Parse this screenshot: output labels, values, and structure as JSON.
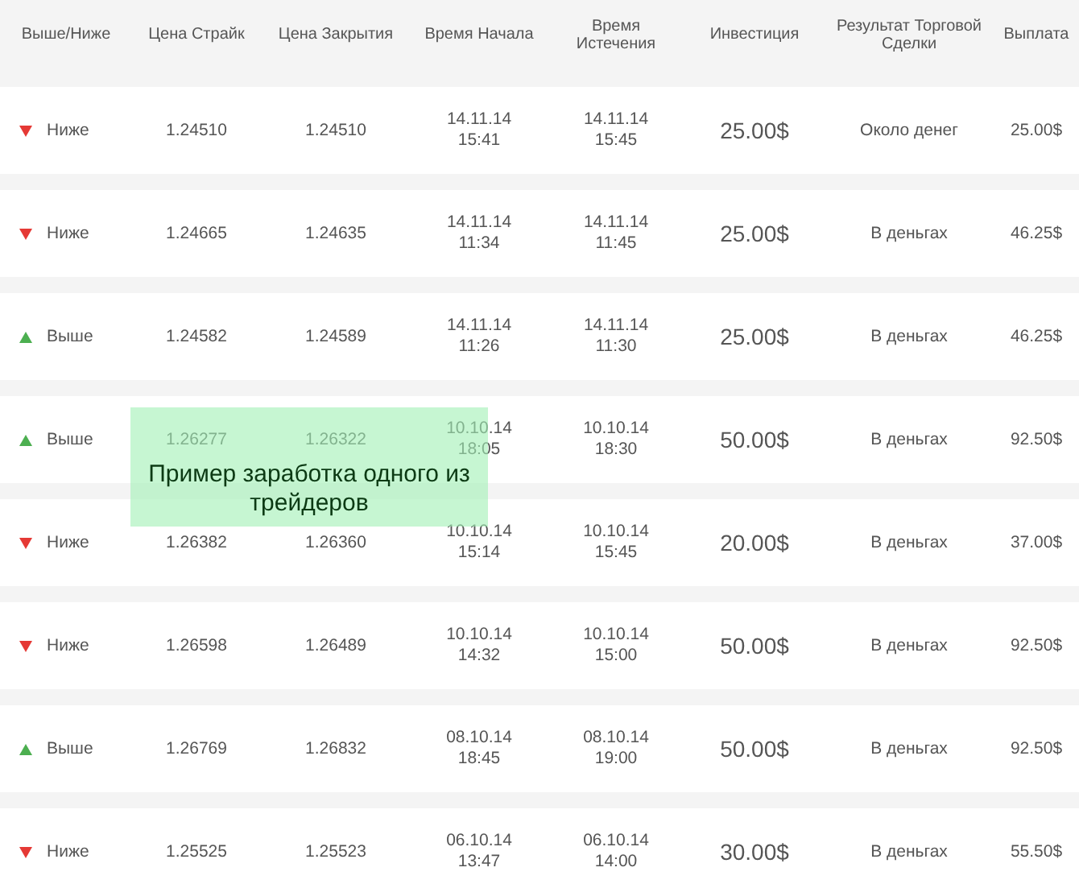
{
  "columns": [
    "Выше/Ниже",
    "Цена Страйк",
    "Цена Закрытия",
    "Время Начала",
    "Время Истечения",
    "Инвестиция",
    "Результат Торговой Сделки",
    "Выплата"
  ],
  "rows": [
    {
      "kind": "down",
      "label": "Ниже",
      "strike": "1.24510",
      "close": "1.24510",
      "start_date": "14.11.14",
      "start_time": "15:41",
      "expiry_date": "14.11.14",
      "expiry_time": "15:45",
      "investment": "25.00$",
      "result": "Около денег",
      "payout": "25.00$"
    },
    {
      "kind": "down",
      "label": "Ниже",
      "strike": "1.24665",
      "close": "1.24635",
      "start_date": "14.11.14",
      "start_time": "11:34",
      "expiry_date": "14.11.14",
      "expiry_time": "11:45",
      "investment": "25.00$",
      "result": "В деньгах",
      "payout": "46.25$"
    },
    {
      "kind": "up",
      "label": "Выше",
      "strike": "1.24582",
      "close": "1.24589",
      "start_date": "14.11.14",
      "start_time": "11:26",
      "expiry_date": "14.11.14",
      "expiry_time": "11:30",
      "investment": "25.00$",
      "result": "В деньгах",
      "payout": "46.25$"
    },
    {
      "kind": "up",
      "label": "Выше",
      "strike": "1.26277",
      "close": "1.26322",
      "start_date": "10.10.14",
      "start_time": "18:05",
      "expiry_date": "10.10.14",
      "expiry_time": "18:30",
      "investment": "50.00$",
      "result": "В деньгах",
      "payout": "92.50$"
    },
    {
      "kind": "down",
      "label": "Ниже",
      "strike": "1.26382",
      "close": "1.26360",
      "start_date": "10.10.14",
      "start_time": "15:14",
      "expiry_date": "10.10.14",
      "expiry_time": "15:45",
      "investment": "20.00$",
      "result": "В деньгах",
      "payout": "37.00$"
    },
    {
      "kind": "down",
      "label": "Ниже",
      "strike": "1.26598",
      "close": "1.26489",
      "start_date": "10.10.14",
      "start_time": "14:32",
      "expiry_date": "10.10.14",
      "expiry_time": "15:00",
      "investment": "50.00$",
      "result": "В деньгах",
      "payout": "92.50$"
    },
    {
      "kind": "up",
      "label": "Выше",
      "strike": "1.26769",
      "close": "1.26832",
      "start_date": "08.10.14",
      "start_time": "18:45",
      "expiry_date": "08.10.14",
      "expiry_time": "19:00",
      "investment": "50.00$",
      "result": "В деньгах",
      "payout": "92.50$"
    },
    {
      "kind": "down",
      "label": "Ниже",
      "strike": "1.25525",
      "close": "1.25523",
      "start_date": "06.10.14",
      "start_time": "13:47",
      "expiry_date": "06.10.14",
      "expiry_time": "14:00",
      "investment": "30.00$",
      "result": "В деньгах",
      "payout": "55.50$"
    }
  ],
  "note": "Пример заработка одного из трейдеров"
}
